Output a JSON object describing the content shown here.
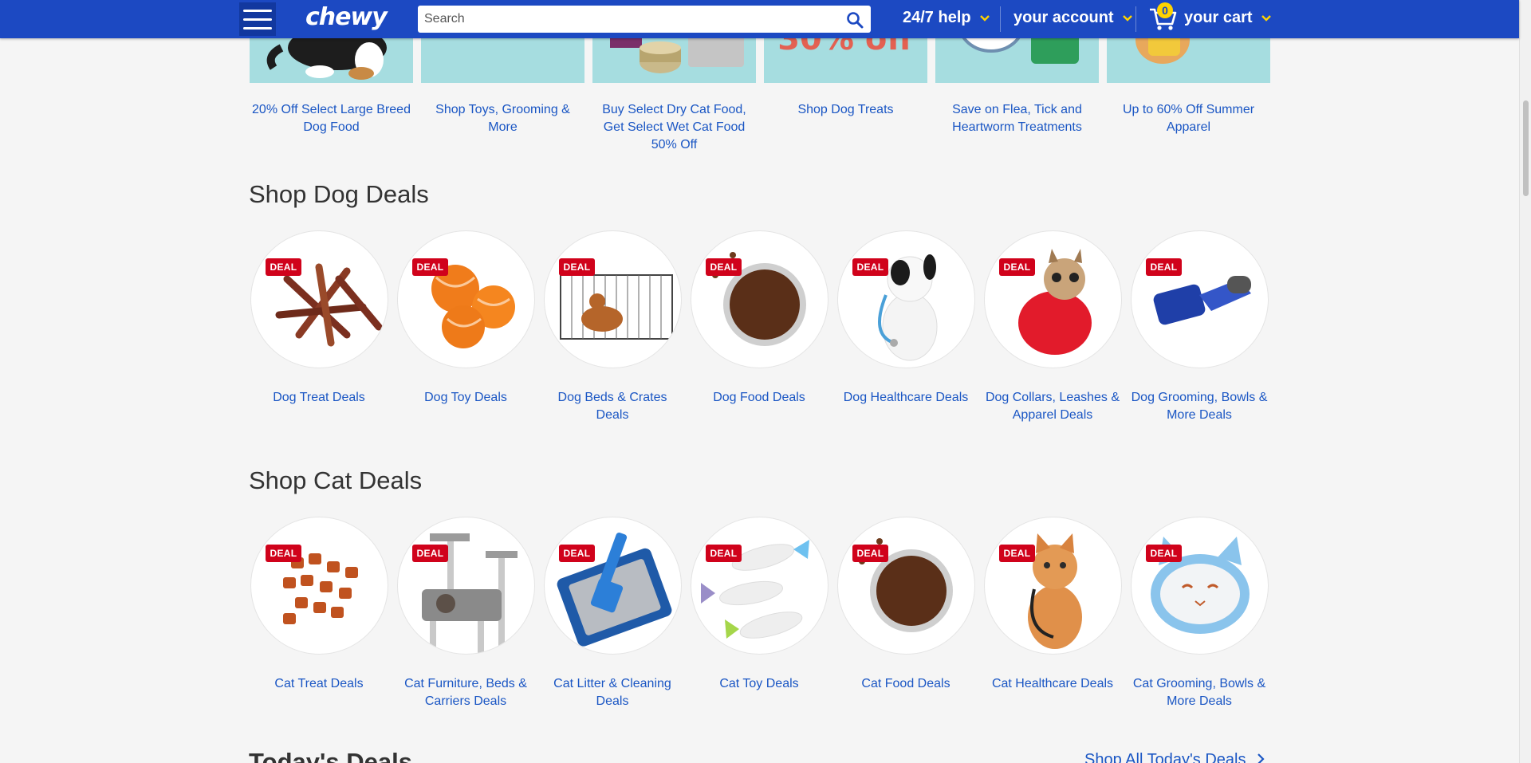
{
  "header": {
    "logo": "chewy",
    "search_placeholder": "Search",
    "help_label": "24/7 help",
    "account_label": "your account",
    "cart_label": "your cart",
    "cart_count": "0"
  },
  "promos": [
    {
      "label": "20% Off Select Large Breed Dog Food"
    },
    {
      "label": "Shop Toys, Grooming & More"
    },
    {
      "label": "Buy Select Dry Cat Food, Get Select Wet Cat Food 50% Off"
    },
    {
      "label": "Shop Dog Treats"
    },
    {
      "label": "Save on Flea, Tick and Heartworm Treatments"
    },
    {
      "label": "Up to 60% Off Summer Apparel"
    }
  ],
  "dog_section": {
    "title": "Shop Dog Deals",
    "items": [
      {
        "label": "Dog Treat Deals",
        "badge": "DEAL"
      },
      {
        "label": "Dog Toy Deals",
        "badge": "DEAL"
      },
      {
        "label": "Dog Beds & Crates Deals",
        "badge": "DEAL"
      },
      {
        "label": "Dog Food Deals",
        "badge": "DEAL"
      },
      {
        "label": "Dog Healthcare Deals",
        "badge": "DEAL"
      },
      {
        "label": "Dog Collars, Leashes & Apparel Deals",
        "badge": "DEAL"
      },
      {
        "label": "Dog Grooming, Bowls & More Deals",
        "badge": "DEAL"
      }
    ]
  },
  "cat_section": {
    "title": "Shop Cat Deals",
    "items": [
      {
        "label": "Cat Treat Deals",
        "badge": "DEAL"
      },
      {
        "label": "Cat Furniture, Beds & Carriers Deals",
        "badge": "DEAL"
      },
      {
        "label": "Cat Litter & Cleaning Deals",
        "badge": "DEAL"
      },
      {
        "label": "Cat Toy Deals",
        "badge": "DEAL"
      },
      {
        "label": "Cat Food Deals",
        "badge": "DEAL"
      },
      {
        "label": "Cat Healthcare Deals",
        "badge": "DEAL"
      },
      {
        "label": "Cat Grooming, Bowls & More Deals",
        "badge": "DEAL"
      }
    ]
  },
  "todays_deals": {
    "title": "Today's Deals",
    "shop_all": "Shop All Today's Deals"
  },
  "colors": {
    "brand_blue": "#1c49c2",
    "link_blue": "#1a56c4",
    "deal_red": "#d0021b",
    "accent_yellow": "#ffd300"
  }
}
